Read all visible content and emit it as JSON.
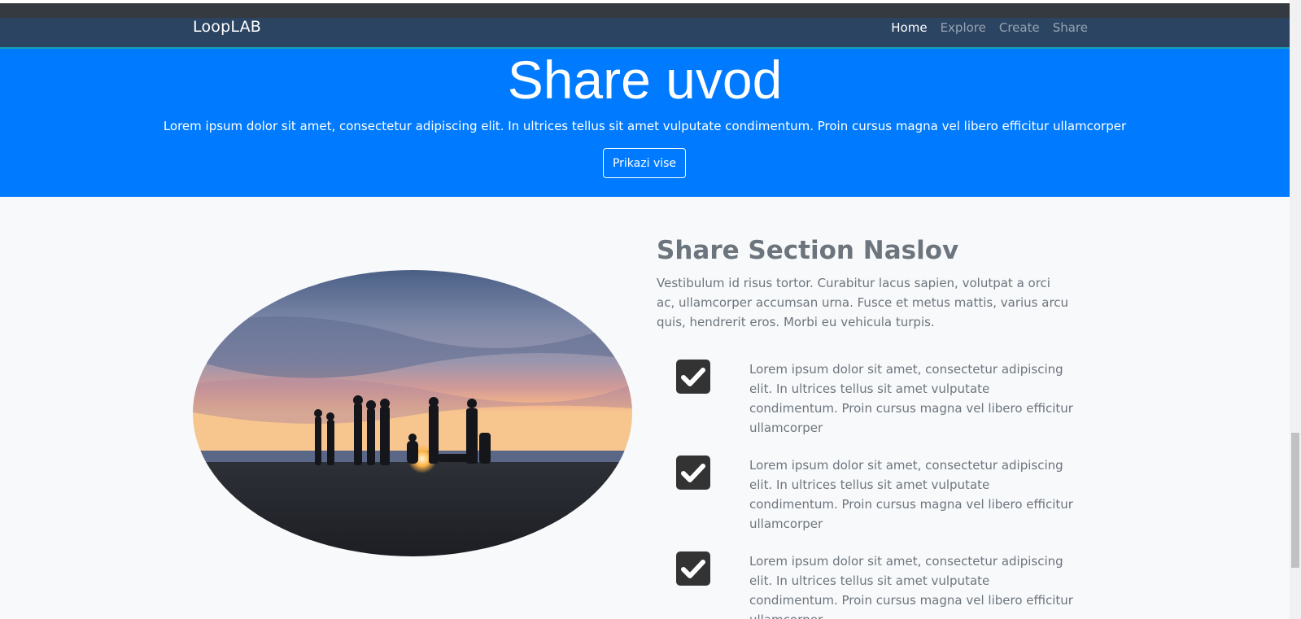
{
  "navbar": {
    "brand": "LoopLAB",
    "links": [
      {
        "label": "Home",
        "active": true
      },
      {
        "label": "Explore",
        "active": false
      },
      {
        "label": "Create",
        "active": false
      },
      {
        "label": "Share",
        "active": false
      }
    ]
  },
  "hero": {
    "title": "Share uvod",
    "text": "Lorem ipsum dolor sit amet, consectetur adipiscing elit. In ultrices tellus sit amet vulputate condimentum. Proin cursus magna vel libero efficitur ullamcorper",
    "button_label": "Prikazi vise"
  },
  "section": {
    "title": "Share Section Naslov",
    "text": "Vestibulum id risus tortor. Curabitur lacus sapien, volutpat a orci ac, ullamcorper accumsan urna. Fusce et metus mattis, varius arcu quis, hendrerit eros. Morbi eu vehicula turpis.",
    "features": [
      {
        "icon": "check-square-icon",
        "text": "Lorem ipsum dolor sit amet, consectetur adipiscing elit. In ultrices tellus sit amet vulputate condimentum. Proin cursus magna vel libero efficitur ullamcorper"
      },
      {
        "icon": "check-square-icon",
        "text": "Lorem ipsum dolor sit amet, consectetur adipiscing elit. In ultrices tellus sit amet vulputate condimentum. Proin cursus magna vel libero efficitur ullamcorper"
      },
      {
        "icon": "check-square-icon",
        "text": "Lorem ipsum dolor sit amet, consectetur adipiscing elit. In ultrices tellus sit amet vulputate condimentum. Proin cursus magna vel libero efficitur ullamcorper"
      }
    ]
  },
  "colors": {
    "navbar_bg": "#2b4462",
    "hero_bg": "#007bff",
    "section_bg": "#f8f9fa",
    "text_muted": "#6c757d"
  }
}
